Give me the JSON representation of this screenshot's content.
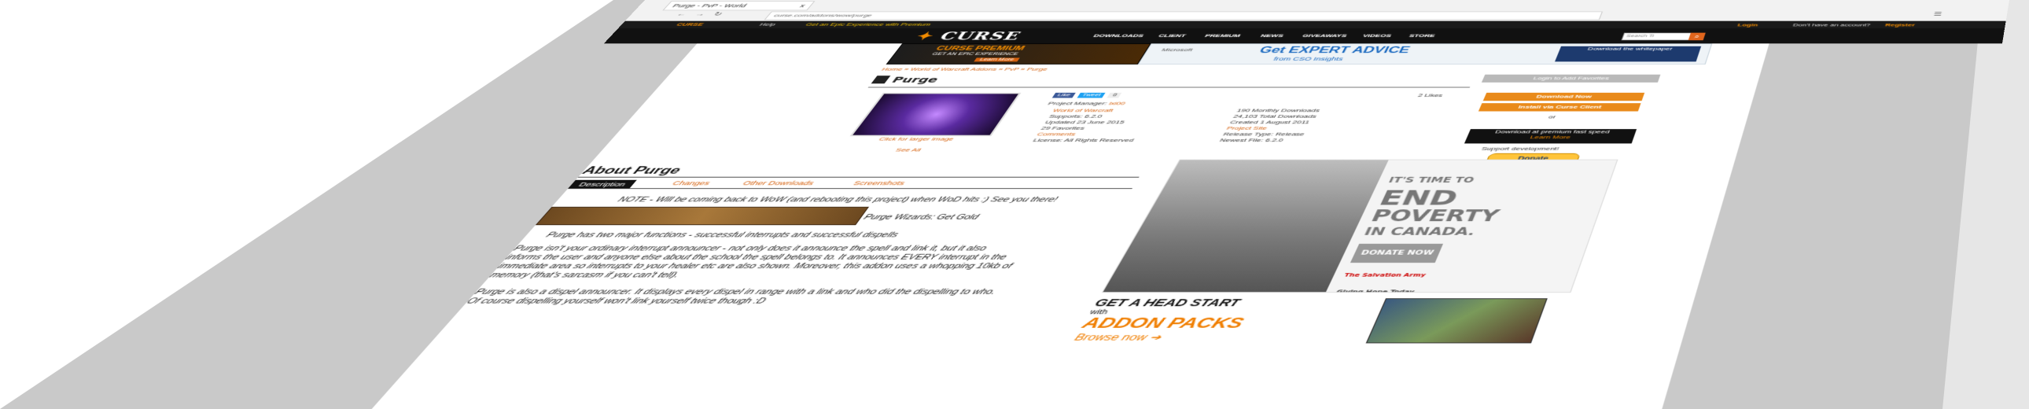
{
  "browser": {
    "tab_title": "Purge - PvP - World",
    "url": "curse.com/addons/wow/purge",
    "tab_close": "x"
  },
  "topbar": {
    "logo": "CURSE",
    "logo_sub": "Help",
    "promo": "Get an Epic Experience with Premium",
    "login": "Login",
    "no_account": "Don't have an account?",
    "register": "Register"
  },
  "mainnav": {
    "logo": "CURSE",
    "items": [
      "DOWNLOADS",
      "CLIENT",
      "PREMIUM",
      "NEWS",
      "GIVEAWAYS",
      "VIDEOS",
      "STORE"
    ],
    "search_placeholder": "Search Ti"
  },
  "banners": {
    "premium_title": "CURSE PREMIUM",
    "premium_line": "GET AN EPIC EXPERIENCE",
    "premium_learn": "Learn More",
    "ms_brand": "Microsoft",
    "ms_headline": "Get EXPERT ADVICE",
    "ms_sub": "from CSO Insights",
    "ms_cta": "Download the whitepaper"
  },
  "breadcrumb": "Home » World of Warcraft Addons » PvP » Purge",
  "project": {
    "title": "Purge",
    "add_favorites": "Login to Add Favorites",
    "likes": "2 Likes",
    "manager_label": "Project Manager:",
    "manager": "lxi00",
    "game": "World of Warcraft",
    "supports": "Supports: 6.2.0",
    "updated": "Updated 23 June 2015",
    "favorites": "29 Favorites",
    "comments": "Comments",
    "license": "License: All Rights Reserved",
    "monthly": "190 Monthly Downloads",
    "total": "24,103 Total Downloads",
    "created": "Created 1 August 2011",
    "project_site": "Project Site",
    "release_type": "Release Type: Release",
    "newest_file": "Newest File: 6.2.0",
    "click_larger": "Click for larger image",
    "see_all": "See All",
    "social_like": "Like",
    "social_tweet": "Tweet",
    "social_count": "0"
  },
  "downloads": {
    "download_now": "Download Now",
    "install_client": "Install via Curse Client",
    "or": "or",
    "premium_dl": "Download at premium fast speed",
    "learn_more": "Learn More",
    "support": "Support development!",
    "donate": "Donate"
  },
  "about": {
    "heading": "About Purge",
    "tabs": [
      "Description",
      "Changes",
      "Other Downloads",
      "Screenshots"
    ],
    "note": "NOTE - Will be coming back to WoW (and rebooting this project) when WoD hits :) See you there!",
    "img_caption": "Purge Wizards: Get Gold",
    "p1": "Purge has two major functions - successful interrupts and successful dispells",
    "p2a": "Purge isn't your ordinary interrupt announcer - not only does it announce the spell and link it, but it also",
    "p2b": "informs the user and anyone else about the school the spell belongs to. It announces EVERY interrupt in the",
    "p2c": "immediate area so interrupts to your healer etc are also shown. Moreover, this addon uses a whopping 10kb of",
    "p2d": "memory (that's sarcasm if you can't tell).",
    "p3a": "Purge is also a dispel announcer. It displays every dispel in range with a link and who did the dispelling to who.",
    "p3b": "Of course dispelling yourself won't link yourself twice though :D"
  },
  "side_ad": {
    "line1": "IT'S TIME TO",
    "line2": "END",
    "line3": "POVERTY",
    "line4": "IN CANADA.",
    "donate": "DONATE NOW",
    "brand": "The Salvation Army",
    "tagline": "Giving Hope Today"
  },
  "addon_ad": {
    "head": "GET A HEAD START",
    "with": "with",
    "big": "ADDON PACKS",
    "browse": "Browse now"
  }
}
